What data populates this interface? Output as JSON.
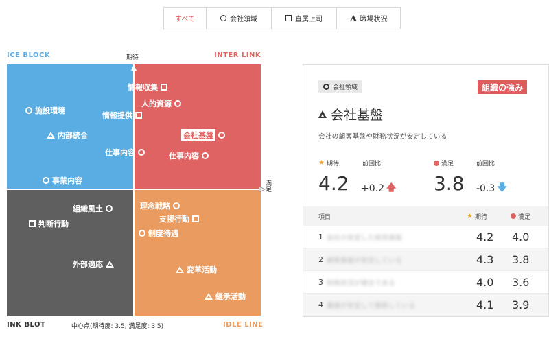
{
  "tabs": [
    {
      "label": "すべて",
      "icon": "none",
      "active": true
    },
    {
      "label": "会社領域",
      "icon": "circle-icon",
      "active": false
    },
    {
      "label": "直属上司",
      "icon": "square-icon",
      "active": false
    },
    {
      "label": "職場状況",
      "icon": "triangle-icon",
      "active": false
    }
  ],
  "matrix": {
    "corners": {
      "top_left": "ICE BLOCK",
      "top_right": "INTER LINK",
      "bottom_left": "INK BLOT",
      "bottom_right": "IDLE LINE"
    },
    "y_axis_label": "期待",
    "x_axis_label": "満足",
    "center_note": "中心点(期待度: 3.5, 満足度: 3.5)",
    "colors": {
      "top_left": "#5aade3",
      "top_right": "#e06363",
      "bottom_left": "#5f5f5f",
      "bottom_right": "#ea9b5f"
    },
    "markers": {
      "m01": "情報収集",
      "m02": "人的資源",
      "m03": "情報提供",
      "m04": "会社基盤",
      "m05": "仕事内容",
      "m06": "仕事内容",
      "m07": "施設環境",
      "m08": "内部統合",
      "m09": "事業内容",
      "m10": "組織風土",
      "m11": "判断行動",
      "m12": "外部適応",
      "m13": "理念戦略",
      "m14": "支援行動",
      "m15": "制度待遇",
      "m16": "変革活動",
      "m17": "継承活動"
    }
  },
  "detail": {
    "category_chip": "会社領域",
    "badge": "組織の強み",
    "title": "会社基盤",
    "description": "会社の顧客基盤や財務状況が安定している",
    "expectation_label": "期待",
    "satisfaction_label": "満足",
    "prev_label": "前回比",
    "expectation_value": "4.2",
    "expectation_delta": "+0.2",
    "satisfaction_value": "3.8",
    "satisfaction_delta": "-0.3",
    "accent_colors": {
      "up": "#e06363",
      "down": "#5aade3",
      "star": "#f0a830"
    },
    "table": {
      "headers": {
        "item": "項目",
        "expectation": "期待",
        "satisfaction": "満足"
      },
      "rows": [
        {
          "no": "1",
          "name": "会社の安定した経営基盤",
          "exp": "4.2",
          "sat": "4.0"
        },
        {
          "no": "2",
          "name": "顧客基盤が安定している",
          "exp": "4.3",
          "sat": "3.8"
        },
        {
          "no": "3",
          "name": "財務状況が健全である",
          "exp": "4.0",
          "sat": "3.6"
        },
        {
          "no": "4",
          "name": "業績が安定して推移している",
          "exp": "4.1",
          "sat": "3.9"
        }
      ]
    }
  }
}
